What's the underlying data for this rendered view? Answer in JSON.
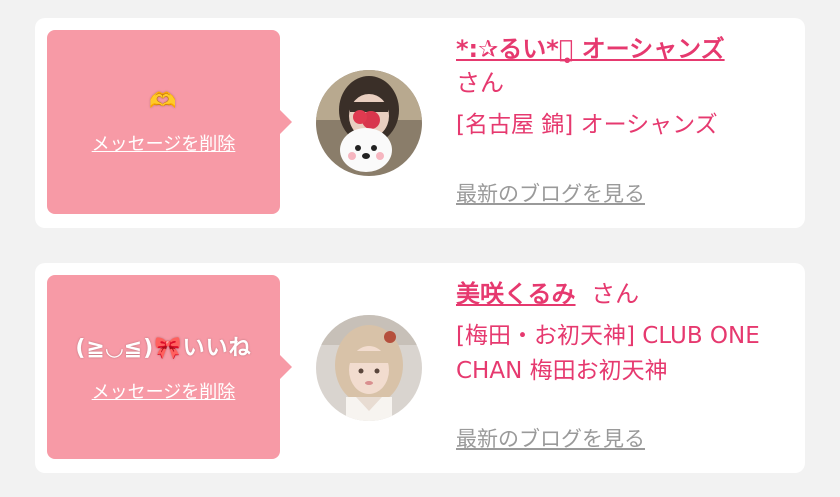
{
  "messages": [
    {
      "text": "🫶",
      "delete_label": "メッセージを削除",
      "name": "*:✰るい*：̥ オーシャンズ",
      "honorific": "さん",
      "shop": "[名古屋 錦] オーシャンズ",
      "blog_label": "最新のブログを見る"
    },
    {
      "text": "(⁠≧⁠◡⁠≦⁠)🎀いいね",
      "delete_label": "メッセージを削除",
      "name": "美咲くるみ",
      "honorific": "さん",
      "shop": "[梅田・お初天神] CLUB ONE CHAN 梅田お初天神",
      "blog_label": "最新のブログを見る"
    }
  ],
  "colors": {
    "accent": "#e6396f",
    "bubble": "#f79aa6",
    "muted": "#9a9a9a",
    "background": "#f2f2f2"
  }
}
